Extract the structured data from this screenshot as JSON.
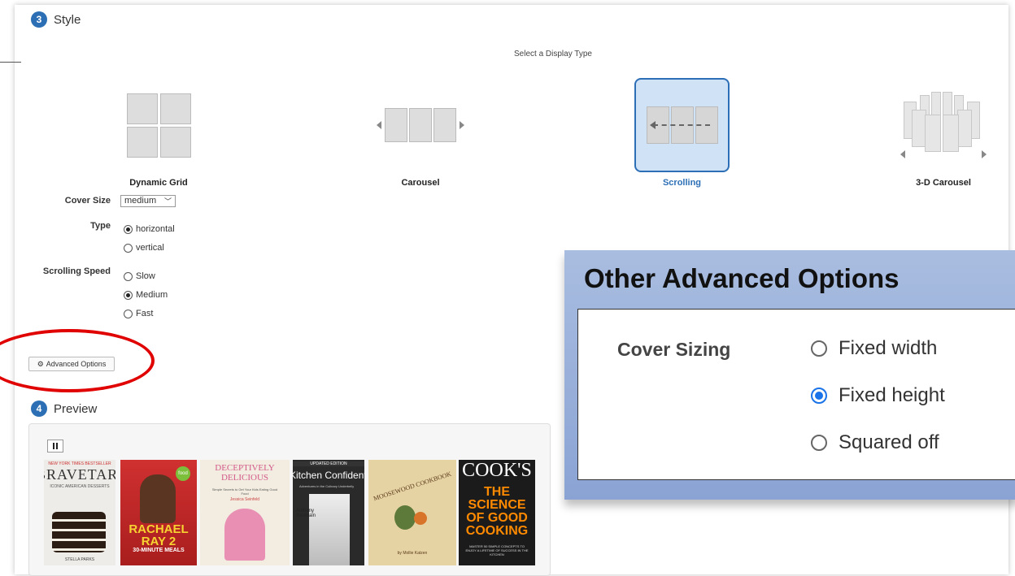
{
  "style_section": {
    "step_number": "3",
    "title": "Style",
    "select_display_type": "Select a Display Type",
    "display_types": [
      {
        "label": "Dynamic Grid",
        "selected": false
      },
      {
        "label": "Carousel",
        "selected": false
      },
      {
        "label": "Scrolling",
        "selected": true
      },
      {
        "label": "3-D Carousel",
        "selected": false
      }
    ],
    "cover_size": {
      "label": "Cover Size",
      "value": "medium"
    },
    "type": {
      "label": "Type",
      "options": [
        "horizontal",
        "vertical"
      ],
      "selected": "horizontal"
    },
    "scrolling_speed": {
      "label": "Scrolling Speed",
      "options": [
        "Slow",
        "Medium",
        "Fast"
      ],
      "selected": "Medium"
    },
    "advanced_options_button": "Advanced Options"
  },
  "preview_section": {
    "step_number": "4",
    "title": "Preview",
    "books": [
      {
        "title": "BRAVETART",
        "subtitle": "ICONIC AMERICAN DESSERTS",
        "author": "STELLA PARKS",
        "banner": "NEW YORK TIMES BESTSELLER"
      },
      {
        "title": "RACHAEL RAY 2",
        "subtitle": "30-MINUTE MEALS",
        "author": "",
        "banner": "food"
      },
      {
        "title": "DECEPTIVELY DELICIOUS",
        "subtitle": "Simple Secrets to Get Your Kids Eating Good Food",
        "author": "Jessica Seinfeld",
        "banner": ""
      },
      {
        "title": "Kitchen Confidential",
        "subtitle": "Adventures in the Culinary Underbelly",
        "author": "Anthony Bourdain",
        "banner": "UPDATED EDITION"
      },
      {
        "title": "MOOSEWOOD COOKBOOK",
        "subtitle": "",
        "author": "by Mollie Katzen",
        "banner": ""
      },
      {
        "title": "COOK'S",
        "subtitle": "THE SCIENCE OF GOOD COOKING",
        "author": "",
        "banner": "MASTER 50 SIMPLE CONCEPTS TO ENJOY A LIFETIME OF SUCCESS IN THE KITCHEN"
      }
    ]
  },
  "callout": {
    "title": "Other Advanced Options",
    "cover_sizing": {
      "label": "Cover Sizing",
      "options": [
        "Fixed width",
        "Fixed height",
        "Squared off"
      ],
      "selected": "Fixed height"
    }
  },
  "colors": {
    "accent": "#2d6fb6",
    "highlight_ellipse": "#e00000",
    "callout_bg": "#9fb4dc",
    "radio_checked": "#1a73e8"
  }
}
